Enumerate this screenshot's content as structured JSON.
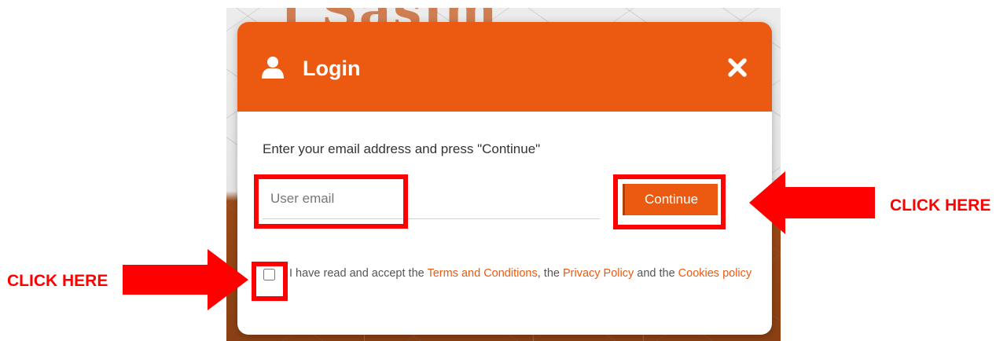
{
  "background": {
    "partial_heading": "l Sasim"
  },
  "modal": {
    "title": "Login",
    "instruction": "Enter your email address and press \"Continue\"",
    "email": {
      "value": "",
      "placeholder": "User email"
    },
    "continue_label": "Continue",
    "terms": {
      "checked": false,
      "prefix": "I have read and accept the ",
      "terms_link": "Terms and Conditions",
      "mid1": ", the ",
      "privacy_link": "Privacy Policy",
      "mid2": " and the ",
      "cookies_link": "Cookies policy"
    }
  },
  "annotations": {
    "right_callout": "CLICK HERE",
    "left_callout": "CLICK HERE",
    "highlight_color": "#ff0000"
  },
  "colors": {
    "brand_orange": "#ec5a11",
    "text": "#333333"
  },
  "icons": {
    "header": "user-icon",
    "close": "close-icon"
  }
}
